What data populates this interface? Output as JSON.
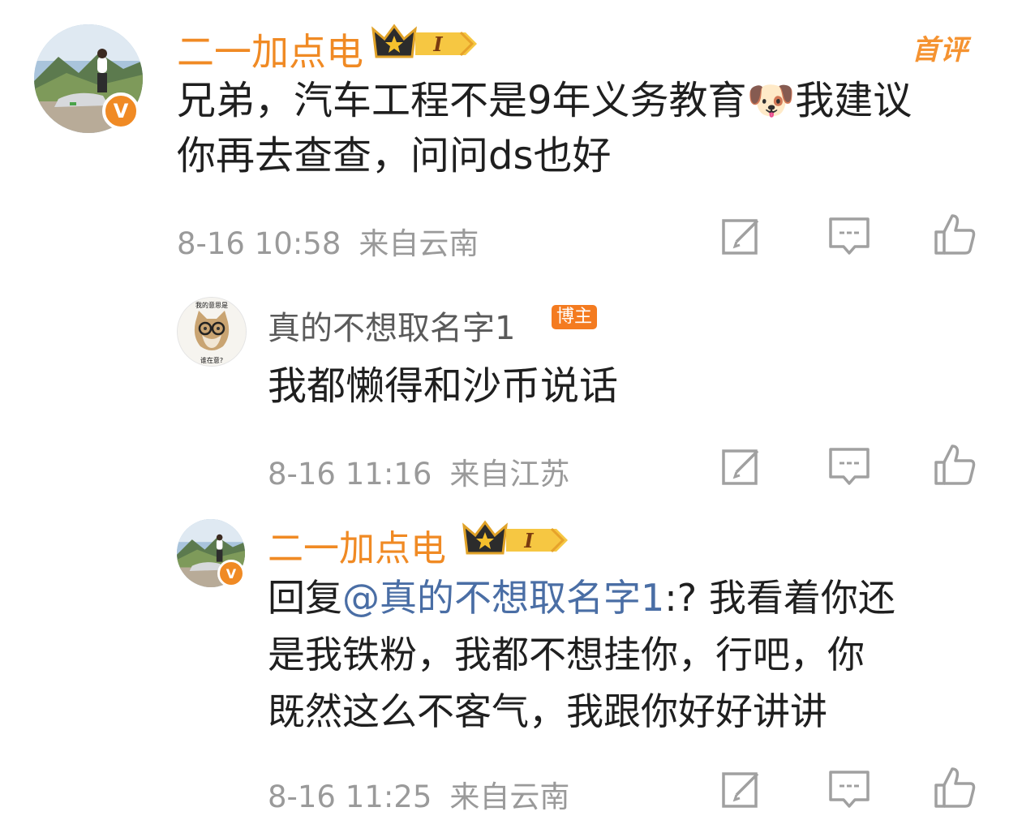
{
  "comments": [
    {
      "username": "二一加点电",
      "badge_level": "I",
      "tag": "首评",
      "lines": [
        "兄弟，汽车工程不是9年义务教育🐶我建议",
        "你再去查查，问问ds也好"
      ],
      "time": "8-16 10:58",
      "location": "来自云南"
    },
    {
      "username": "真的不想取名字1",
      "badge": "博主",
      "avatar_text_top": "我的意思是",
      "avatar_text_bottom": "谁在意?",
      "lines": [
        "我都懒得和沙币说话"
      ],
      "time": "8-16 11:16",
      "location": "来自江苏"
    },
    {
      "username": "二一加点电",
      "badge_level": "I",
      "reply_prefix": "回复",
      "reply_mention": "@真的不想取名字1",
      "reply_rest": ":? 我看着你还",
      "lines": [
        "是我铁粉，我都不想挂你，行吧，你",
        "既然这么不客气，我跟你好好讲讲"
      ],
      "time": "8-16 11:25",
      "location": "来自云南"
    }
  ],
  "colors": {
    "username_orange": "#f08a24",
    "mention_blue": "#4a6ea5",
    "meta_gray": "#9a9a9a",
    "icon_gray": "#a0a0a0"
  },
  "icons": [
    "edit-icon",
    "comment-icon",
    "like-icon",
    "crown-icon",
    "verified-icon"
  ]
}
